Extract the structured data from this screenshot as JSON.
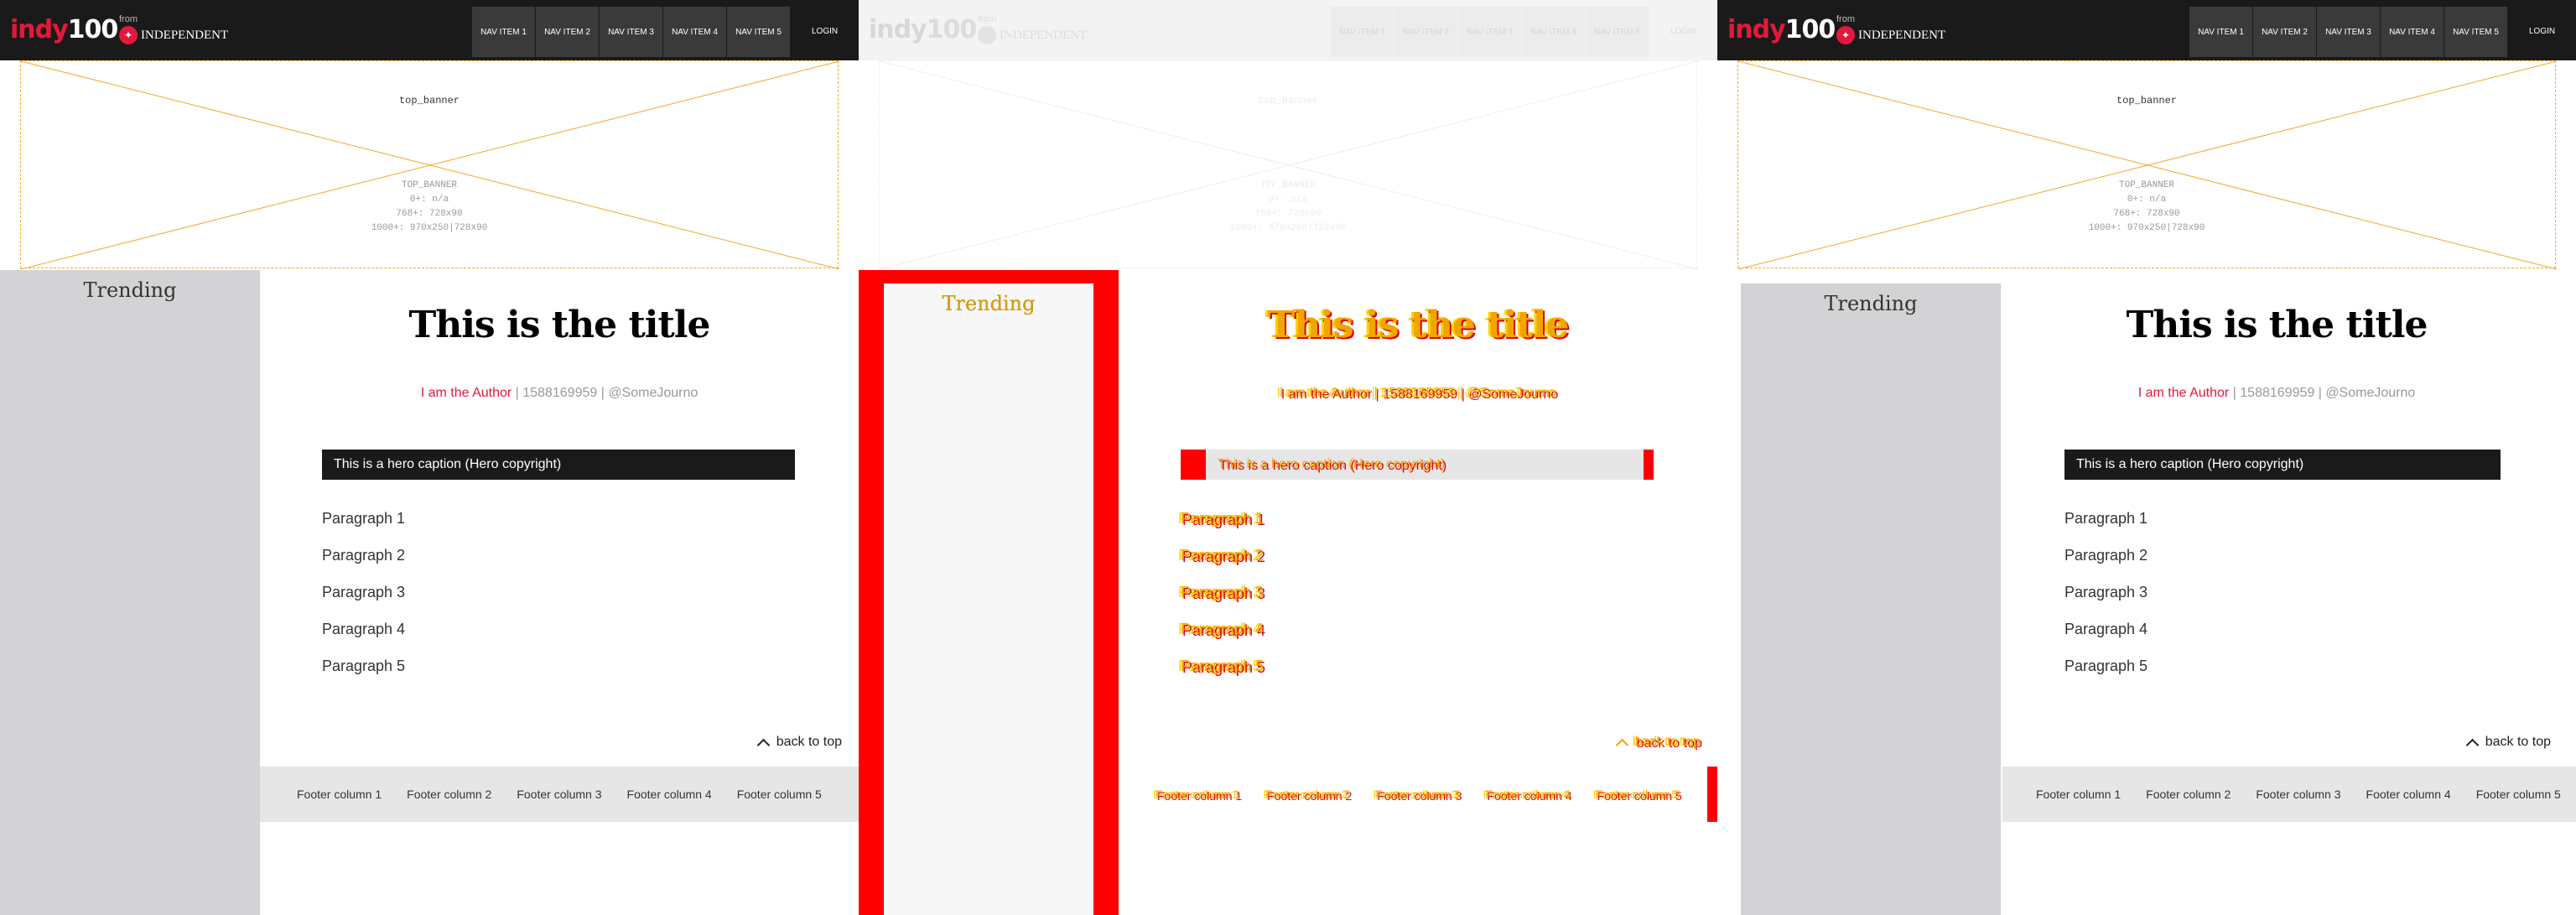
{
  "brand": {
    "logo_prefix": "indy",
    "logo_number": "100",
    "from_text": "from",
    "publisher_name": "INDEPENDENT",
    "publisher_icon": "eagle-icon"
  },
  "nav": {
    "items": [
      "NAV ITEM 1",
      "NAV ITEM 2",
      "NAV ITEM 3",
      "NAV ITEM 4",
      "NAV ITEM 5"
    ],
    "login_label": "LOGIN"
  },
  "banner": {
    "label": "top_banner",
    "spec_lines": [
      "TOP_BANNER",
      "0+: n/a",
      "768+: 728x90",
      "1000+: 970x250|728x90"
    ]
  },
  "sidebar": {
    "title": "Trending"
  },
  "article": {
    "title": "This is the title",
    "author": "I am the Author",
    "separator": " | ",
    "timestamp": "1588169959",
    "social_prefix": " | ",
    "handle": "@SomeJourno",
    "hero_caption": "This is a hero caption (Hero copyright)",
    "paragraphs": [
      "Paragraph 1",
      "Paragraph 2",
      "Paragraph 3",
      "Paragraph 4",
      "Paragraph 5"
    ]
  },
  "back_to_top": {
    "label": "back to top",
    "icon": "chevron-up-icon"
  },
  "footer": {
    "columns": [
      "Footer column 1",
      "Footer column 2",
      "Footer column 3",
      "Footer column 4",
      "Footer column 5"
    ]
  },
  "colors": {
    "accent": "#e3193b",
    "header_bg": "#1a1a1a",
    "sidebar_bg": "#d3d3d5",
    "banner_outline": "#f5a623",
    "diff_highlight": "#ff0000",
    "diff_text": "#f0a500"
  }
}
